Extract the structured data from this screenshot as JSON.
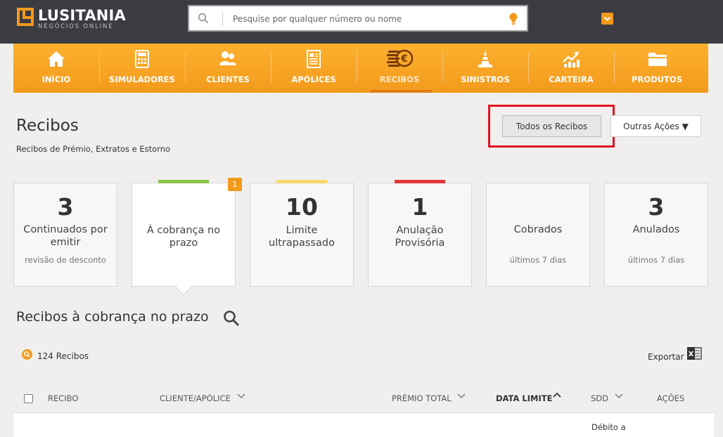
{
  "brand": {
    "name": "LUSITANIA",
    "subtitle": "NEGÓCIOS ONLINE"
  },
  "search": {
    "placeholder": "Pesquise por qualquer número ou nome"
  },
  "nav": [
    {
      "label": "INÍCIO",
      "icon": "home-icon"
    },
    {
      "label": "SIMULADORES",
      "icon": "calculator-icon"
    },
    {
      "label": "CLIENTES",
      "icon": "users-icon"
    },
    {
      "label": "APÓLICES",
      "icon": "document-icon"
    },
    {
      "label": "RECIBOS",
      "icon": "euro-coins-icon",
      "active": true
    },
    {
      "label": "SINISTROS",
      "icon": "traffic-cone-icon"
    },
    {
      "label": "CARTEIRA",
      "icon": "growth-chart-icon"
    },
    {
      "label": "PRODUTOS",
      "icon": "folder-icon"
    }
  ],
  "page": {
    "title": "Recibos",
    "subtitle": "Recibos de Prémio, Extratos e Estorno",
    "btn_all": "Todos os Recibos",
    "btn_more": "Outras Ações ▼"
  },
  "cards": [
    {
      "number": "3",
      "label": "Continuados por emitir",
      "sub": "revisão de desconto"
    },
    {
      "number": "",
      "label": "À cobrança no prazo",
      "sub": "",
      "stripe": "#8bc34a",
      "badge": "1",
      "selected": true
    },
    {
      "number": "10",
      "label": "Limite ultrapassado",
      "sub": "",
      "stripe": "#f5d76e"
    },
    {
      "number": "1",
      "label": "Anulação Provisória",
      "sub": "",
      "stripe": "#e0363a"
    },
    {
      "number": "",
      "label": "Cobrados",
      "sub": "últimos 7 dias"
    },
    {
      "number": "3",
      "label": "Anulados",
      "sub": "últimos 7 dias"
    }
  ],
  "section": {
    "title": "Recibos à cobrança no prazo",
    "count": "124 Recibos",
    "export": "Exportar"
  },
  "table": {
    "headers": [
      "RECIBO",
      "CLIENTE/APÓLICE",
      "PRÉMIO TOTAL",
      "DATA LIMITE",
      "SDD",
      "AÇÕES"
    ],
    "first_row_sdd": "Débito a"
  },
  "colors": {
    "accent": "#f39a1c",
    "header": "#3a3c42",
    "highlight": "#e0141e"
  }
}
